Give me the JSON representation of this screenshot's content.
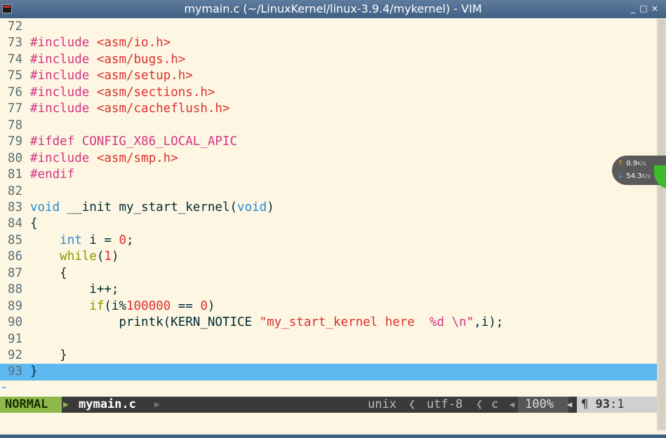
{
  "window": {
    "title": "mymain.c (~/LinuxKernel/linux-3.9.4/mykernel) - VIM",
    "controls": {
      "minimize": "_",
      "maximize": "□",
      "close": "×"
    }
  },
  "colors": {
    "keyword_green": "#859900",
    "preproc_magenta": "#d33682",
    "string_red": "#dc322f",
    "type_blue": "#268bd2",
    "cursorline_bg": "#5db8f0",
    "mode_green": "#8fb84a"
  },
  "lines": [
    {
      "num": "72",
      "segs": []
    },
    {
      "num": "73",
      "segs": [
        {
          "t": "#include",
          "c": "pre"
        },
        {
          "t": " ",
          "c": ""
        },
        {
          "t": "<asm/io.h>",
          "c": "str"
        }
      ]
    },
    {
      "num": "74",
      "segs": [
        {
          "t": "#include",
          "c": "pre"
        },
        {
          "t": " ",
          "c": ""
        },
        {
          "t": "<asm/bugs.h>",
          "c": "str"
        }
      ]
    },
    {
      "num": "75",
      "segs": [
        {
          "t": "#include",
          "c": "pre"
        },
        {
          "t": " ",
          "c": ""
        },
        {
          "t": "<asm/setup.h>",
          "c": "str"
        }
      ]
    },
    {
      "num": "76",
      "segs": [
        {
          "t": "#include",
          "c": "pre"
        },
        {
          "t": " ",
          "c": ""
        },
        {
          "t": "<asm/sections.h>",
          "c": "str"
        }
      ]
    },
    {
      "num": "77",
      "segs": [
        {
          "t": "#include",
          "c": "pre"
        },
        {
          "t": " ",
          "c": ""
        },
        {
          "t": "<asm/cacheflush.h>",
          "c": "str"
        }
      ]
    },
    {
      "num": "78",
      "segs": []
    },
    {
      "num": "79",
      "segs": [
        {
          "t": "#ifdef CONFIG_X86_LOCAL_APIC",
          "c": "pre"
        }
      ]
    },
    {
      "num": "80",
      "segs": [
        {
          "t": "#include",
          "c": "pre"
        },
        {
          "t": " ",
          "c": ""
        },
        {
          "t": "<asm/smp.h>",
          "c": "str"
        }
      ]
    },
    {
      "num": "81",
      "segs": [
        {
          "t": "#endif",
          "c": "pre"
        }
      ]
    },
    {
      "num": "82",
      "segs": []
    },
    {
      "num": "83",
      "segs": [
        {
          "t": "void",
          "c": "type"
        },
        {
          "t": " __init my_start_kernel(",
          "c": ""
        },
        {
          "t": "void",
          "c": "type"
        },
        {
          "t": ")",
          "c": ""
        }
      ]
    },
    {
      "num": "84",
      "segs": [
        {
          "t": "{",
          "c": ""
        }
      ]
    },
    {
      "num": "85",
      "segs": [
        {
          "t": "    ",
          "c": ""
        },
        {
          "t": "int",
          "c": "type"
        },
        {
          "t": " i = ",
          "c": ""
        },
        {
          "t": "0",
          "c": "str"
        },
        {
          "t": ";",
          "c": ""
        }
      ]
    },
    {
      "num": "86",
      "segs": [
        {
          "t": "    ",
          "c": ""
        },
        {
          "t": "while",
          "c": "kw"
        },
        {
          "t": "(",
          "c": ""
        },
        {
          "t": "1",
          "c": "str"
        },
        {
          "t": ")",
          "c": ""
        }
      ]
    },
    {
      "num": "87",
      "segs": [
        {
          "t": "    {",
          "c": ""
        }
      ]
    },
    {
      "num": "88",
      "segs": [
        {
          "t": "        i++;",
          "c": ""
        }
      ]
    },
    {
      "num": "89",
      "segs": [
        {
          "t": "        ",
          "c": ""
        },
        {
          "t": "if",
          "c": "kw"
        },
        {
          "t": "(i%",
          "c": ""
        },
        {
          "t": "100000",
          "c": "str"
        },
        {
          "t": " == ",
          "c": ""
        },
        {
          "t": "0",
          "c": "str"
        },
        {
          "t": ")",
          "c": ""
        }
      ]
    },
    {
      "num": "90",
      "segs": [
        {
          "t": "            printk(KERN_NOTICE ",
          "c": ""
        },
        {
          "t": "\"my_start_kernel here  ",
          "c": "str"
        },
        {
          "t": "%d",
          "c": "pre"
        },
        {
          "t": " ",
          "c": "str"
        },
        {
          "t": "\\n",
          "c": "pre"
        },
        {
          "t": "\"",
          "c": "str"
        },
        {
          "t": ",i);",
          "c": ""
        }
      ]
    },
    {
      "num": "91",
      "segs": []
    },
    {
      "num": "92",
      "segs": [
        {
          "t": "    }",
          "c": ""
        }
      ]
    },
    {
      "num": "93",
      "segs": [
        {
          "t": "}",
          "c": "cursor"
        }
      ],
      "cursor": true
    }
  ],
  "tilde": "~",
  "statusline": {
    "mode": "NORMAL",
    "sep_right": "▶",
    "filename": "mymain.c",
    "fileformat": "unix",
    "encoding": "utf-8",
    "filetype": "c",
    "arrow_left": "❮",
    "arrow_small": "◀",
    "percent": "100%",
    "pilcrow": "¶",
    "line": "93",
    "col": ":1"
  },
  "netspeed": {
    "upload": "0.9",
    "upload_unit": "K/s",
    "download": "54.3",
    "download_unit": "K/s",
    "up_arrow": "↑",
    "down_arrow": "↓"
  }
}
